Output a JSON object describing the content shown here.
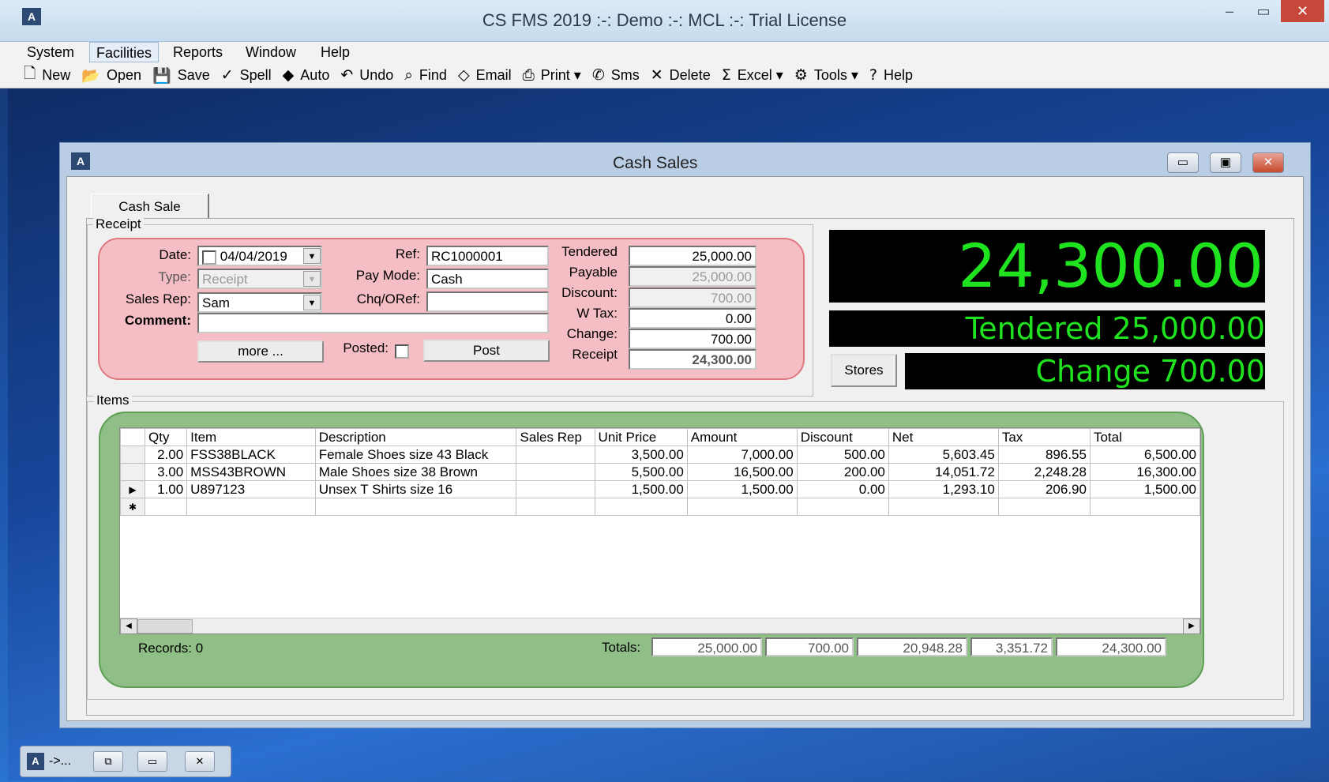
{
  "app": {
    "title": "CS FMS 2019 :-: Demo :-: MCL :-: Trial License",
    "minimize_glyph": "–",
    "maximize_glyph": "▭",
    "close_glyph": "✕"
  },
  "menu": [
    "System",
    "Facilities",
    "Reports",
    "Window",
    "Help"
  ],
  "toolbar": [
    {
      "icon": "new-icon",
      "glyph": "🗋",
      "label": "New"
    },
    {
      "icon": "open-icon",
      "glyph": "📂",
      "label": "Open"
    },
    {
      "icon": "save-icon",
      "glyph": "💾",
      "label": "Save"
    },
    {
      "icon": "spell-icon",
      "glyph": "✓",
      "label": "Spell"
    },
    {
      "icon": "auto-icon",
      "glyph": "◆",
      "label": "Auto"
    },
    {
      "icon": "undo-icon",
      "glyph": "↶",
      "label": "Undo"
    },
    {
      "icon": "find-icon",
      "glyph": "⌕",
      "label": "Find"
    },
    {
      "icon": "email-icon",
      "glyph": "◇",
      "label": "Email"
    },
    {
      "icon": "print-icon",
      "glyph": "⎙",
      "label": "Print ▾"
    },
    {
      "icon": "sms-icon",
      "glyph": "✆",
      "label": "Sms"
    },
    {
      "icon": "delete-icon",
      "glyph": "✕",
      "label": "Delete"
    },
    {
      "icon": "sum-icon",
      "glyph": "Σ",
      "label": "Excel ▾"
    },
    {
      "icon": "tools-icon",
      "glyph": "⚙",
      "label": "Tools ▾"
    },
    {
      "icon": "help-icon",
      "glyph": "?",
      "label": "Help"
    }
  ],
  "child": {
    "title": "Cash Sales",
    "tab": "Cash Sale"
  },
  "receipt": {
    "group_label": "Receipt",
    "date_label": "Date:",
    "date_value": "04/04/2019",
    "type_label": "Type:",
    "type_value": "Receipt",
    "salesrep_label": "Sales Rep:",
    "salesrep_value": "Sam",
    "comment_label": "Comment:",
    "comment_value": "",
    "ref_label": "Ref:",
    "ref_value": "RC1000001",
    "paymode_label": "Pay Mode:",
    "paymode_value": "Cash",
    "chq_label": "Chq/ORef:",
    "chq_value": "",
    "more_button": "more ...",
    "posted_label": "Posted:",
    "post_button": "Post",
    "tendered_label": "Tendered",
    "tendered_value": "25,000.00",
    "payable_label": "Payable",
    "payable_value": "25,000.00",
    "discount_label": "Discount:",
    "discount_value": "700.00",
    "wtax_label": "W Tax:",
    "wtax_value": "0.00",
    "change_label": "Change:",
    "change_value": "700.00",
    "receipt_label": "Receipt",
    "receipt_value": "24,300.00"
  },
  "display": {
    "amount": "24,300.00",
    "tendered": "Tendered 25,000.00",
    "change": "Change 700.00",
    "stores_button": "Stores",
    "lcd_color": "#1fe31f"
  },
  "items": {
    "group_label": "Items",
    "columns": [
      "Qty",
      "Item",
      "Description",
      "Sales Rep",
      "Unit Price",
      "Amount",
      "Discount",
      "Net",
      "Tax",
      "Total"
    ],
    "rows": [
      {
        "qty": "2.00",
        "item": "FSS38BLACK",
        "desc": "Female Shoes size 43 Black",
        "rep": "",
        "price": "3,500.00",
        "amount": "7,000.00",
        "discount": "500.00",
        "net": "5,603.45",
        "tax": "896.55",
        "total": "6,500.00"
      },
      {
        "qty": "3.00",
        "item": "MSS43BROWN",
        "desc": "Male Shoes size 38 Brown",
        "rep": "",
        "price": "5,500.00",
        "amount": "16,500.00",
        "discount": "200.00",
        "net": "14,051.72",
        "tax": "2,248.28",
        "total": "16,300.00"
      },
      {
        "qty": "1.00",
        "item": "U897123",
        "desc": "Unsex T Shirts size 16",
        "rep": "",
        "price": "1,500.00",
        "amount": "1,500.00",
        "discount": "0.00",
        "net": "1,293.10",
        "tax": "206.90",
        "total": "1,500.00"
      }
    ],
    "records": "Records: 0",
    "totals_label": "Totals:",
    "totals": [
      "25,000.00",
      "700.00",
      "20,948.28",
      "3,351.72",
      "24,300.00"
    ]
  },
  "taskbar": {
    "label": "->..."
  }
}
